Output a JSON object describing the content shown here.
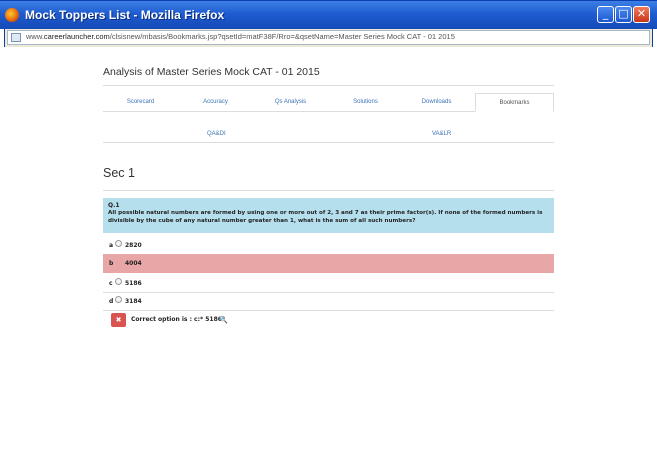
{
  "window": {
    "title": "Mock Toppers List - Mozilla Firefox",
    "url_prefix": "www.",
    "url_domain": "careerlauncher.com",
    "url_rest": "/clsisnew/mbasis/Bookmarks.jsp?qsetId=matF38F/Rro=&qsetName=Master Series Mock CAT - 01 2015",
    "buttons": {
      "minimize": "_",
      "maximize": "□",
      "close": "✕"
    }
  },
  "page": {
    "title": "Analysis of Master Series Mock CAT - 01 2015",
    "tabs": [
      {
        "label": "Scorecard"
      },
      {
        "label": "Accuracy"
      },
      {
        "label": "Qs Analysis"
      },
      {
        "label": "Solutions"
      },
      {
        "label": "Downloads"
      },
      {
        "label": "Bookmarks"
      }
    ],
    "active_tab": "Bookmarks",
    "subtabs": [
      {
        "label": "QA&DI"
      },
      {
        "label": "VA&LR"
      }
    ],
    "section_title": "Sec 1",
    "question": {
      "number": "Q.1",
      "text": "All possible natural numbers are formed by using one or more out of 2, 3 and 7 as their prime factor(s). If none of the formed numbers is divisible by the cube of any natural number greater than 1, what is the sum of all such numbers?"
    },
    "options": [
      {
        "letter": "a",
        "value": "2820",
        "state": "normal"
      },
      {
        "letter": "b",
        "value": "4004",
        "state": "wrong"
      },
      {
        "letter": "c",
        "value": "5186",
        "state": "normal"
      },
      {
        "letter": "d",
        "value": "3184",
        "state": "normal"
      }
    ],
    "answer": {
      "status_icon": "✖",
      "text": "Correct option is : c:* 5186*",
      "key_icon": "🔍"
    }
  },
  "colors": {
    "question_bg": "#b6dfee",
    "wrong_option_bg": "#e9a6a6",
    "answer_icon_bg": "#d9534f",
    "link": "#3b73b9"
  }
}
